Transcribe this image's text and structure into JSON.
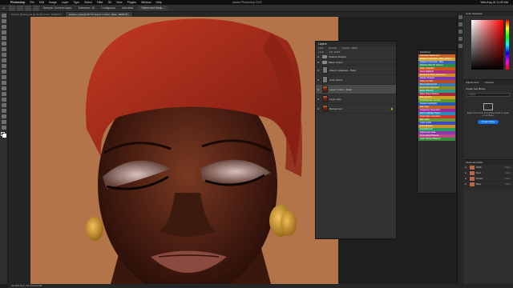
{
  "menubar": {
    "apple": "",
    "items": [
      "Photoshop",
      "File",
      "Edit",
      "Image",
      "Layer",
      "Type",
      "Select",
      "Filter",
      "3D",
      "View",
      "Plugins",
      "Window",
      "Help"
    ],
    "window_title": "Adobe Photoshop 2022",
    "clock": "Wed Aug 24  11:53 AM"
  },
  "options_bar": {
    "home": "⌂",
    "options": [
      "Sample: Current Layer",
      "Tolerance: 10",
      "Contiguous",
      "Anti-alias"
    ],
    "select_mask": "Select and Mask..."
  },
  "tabs": [
    {
      "label": "Portrait_Beauty.psd @ 33.3% (Color, RGB/16*)",
      "active": false
    },
    {
      "label": "sample_Layer@ 66.7% (Layer 1 Color , Base, RGB/16*)",
      "active": true
    }
  ],
  "status_bar": {
    "text": "33.33%    Doc: 111.2M/345.9M"
  },
  "layers_panel": {
    "title": "Layers",
    "row1": [
      "Kind",
      "Normal",
      "Opacity: 100%"
    ],
    "row2": [
      "Lock:",
      "Fill: 100%"
    ],
    "layers": [
      {
        "name": "Shadow Shapes",
        "type": "folder",
        "size": "small",
        "extra": ""
      },
      {
        "name": "Match Colors",
        "type": "folder",
        "size": "small",
        "extra": ""
      },
      {
        "name": "Watch / Shadows - Mask",
        "type": "grey",
        "size": "normal",
        "extra": ""
      },
      {
        "name": "Color Select",
        "type": "grey",
        "size": "normal",
        "extra": ""
      },
      {
        "name": "Layer 1 Color - Mask",
        "type": "photo",
        "size": "normal",
        "extra": "",
        "selected": true
      },
      {
        "name": "Layer copy",
        "type": "photo",
        "size": "normal",
        "extra": ""
      },
      {
        "name": "Background",
        "type": "photo",
        "size": "normal",
        "extra": "🔒"
      }
    ]
  },
  "swatches_panel": {
    "title": "Swatches",
    "items": [
      {
        "label": "Saturated Adjustment",
        "color": "#c8622a"
      },
      {
        "label": "Shadow Correction - Blue gradient",
        "color": "#d4a43a"
      },
      {
        "label": "Shadow Correction - Blue",
        "color": "#3a63b8"
      },
      {
        "label": "Shadow Warmth (Green)",
        "color": "#2f8a4a"
      },
      {
        "label": "Warm Highlight",
        "color": "#c65a1e"
      },
      {
        "label": "Rose Highlight",
        "color": "#b0307a"
      },
      {
        "label": "Saturation Mask Adjustment",
        "color": "#d08a2a"
      },
      {
        "label": "Flatten Shadow",
        "color": "#7a3aa8"
      },
      {
        "label": "Warm-up Skin",
        "color": "#b84a2a"
      },
      {
        "label": "Blend Mask Detail",
        "color": "#3a7aa8"
      },
      {
        "label": "Final Spot Alignment",
        "color": "#8a8a2a"
      },
      {
        "label": "Mask Vibrancy",
        "color": "#2f9a8a"
      },
      {
        "label": "Basic Mask Shadow",
        "color": "#a82a3a"
      },
      {
        "label": "Skin Correct",
        "color": "#c8a02a"
      },
      {
        "label": "Final Retouch Correct",
        "color": "#5a9a2a"
      },
      {
        "label": "Shadow Highlights",
        "color": "#2a5ab8"
      },
      {
        "label": "Skin Tone",
        "color": "#b8642a"
      },
      {
        "label": "Frequency Separation",
        "color": "#9a2a9a"
      },
      {
        "label": "Warm Highlight Depth",
        "color": "#2a8ab8"
      },
      {
        "label": "Final Color Correction",
        "color": "#c8382a"
      },
      {
        "label": "Skin Glow",
        "color": "#6a9a3a"
      },
      {
        "label": "Color Grade",
        "color": "#3a4ab8"
      },
      {
        "label": "Face Shadow",
        "color": "#c8902a"
      },
      {
        "label": "Final Retouch",
        "color": "#2a9a5a"
      },
      {
        "label": "Adjustment Fade",
        "color": "#8a3aa8"
      },
      {
        "label": "Final Adjust Balance",
        "color": "#b84a8a"
      },
      {
        "label": "Color Correct Balance",
        "color": "#3a8a3a"
      }
    ]
  },
  "right_dock": {
    "color_tabs": "Color   Swatches",
    "learn_tabs": [
      "Adjustments",
      "Libraries"
    ],
    "learn_title": "Create new library",
    "search_placeholder": "Search",
    "message": "Begin with assets from Adobe Stock to create a new library",
    "cta": "Create Library",
    "channels_tabs": "Channels   Paths",
    "channels": [
      {
        "name": "RGB",
        "key": "Ctrl+2"
      },
      {
        "name": "Red",
        "key": "Ctrl+3"
      },
      {
        "name": "Green",
        "key": "Ctrl+4"
      },
      {
        "name": "Blue",
        "key": "Ctrl+5"
      }
    ]
  },
  "colors": {
    "accent": "#1473e6",
    "panel": "#323232",
    "photo_bg": "#b3744a"
  }
}
